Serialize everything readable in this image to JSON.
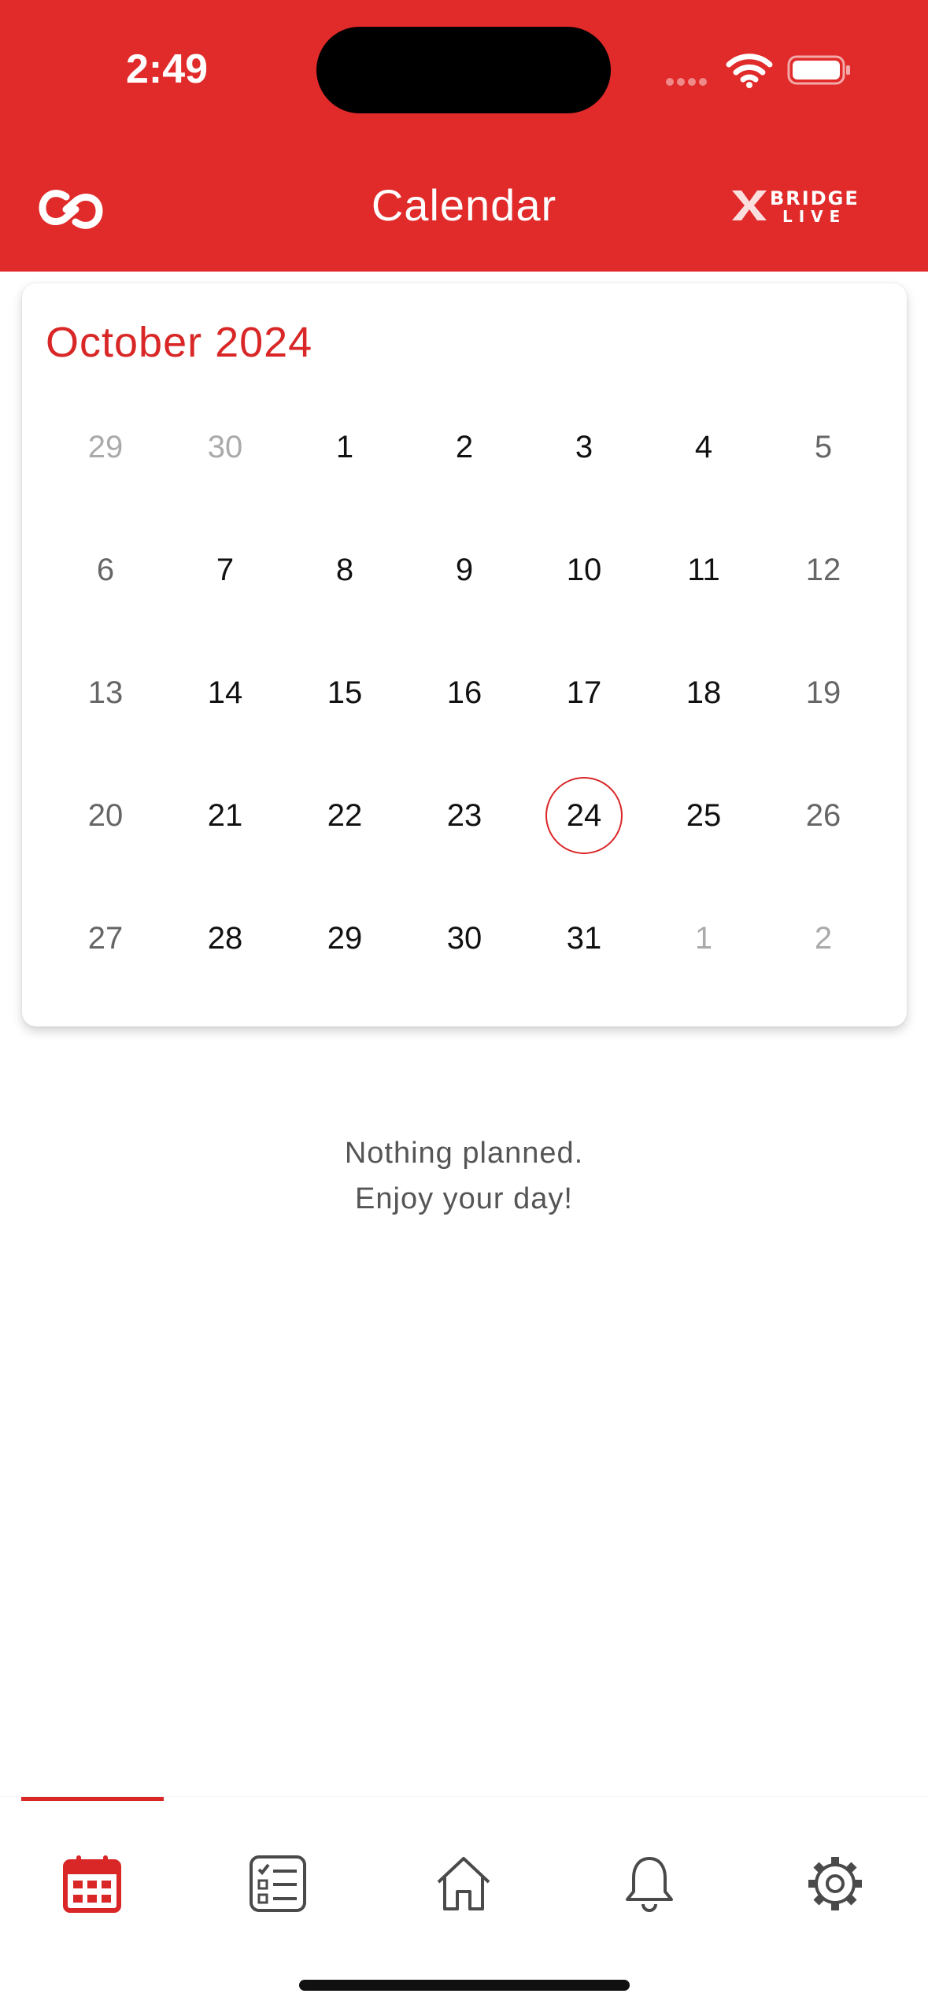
{
  "status_bar": {
    "time": "2:49"
  },
  "header": {
    "title": "Calendar",
    "brand_top": "BRIDGE",
    "brand_bottom": "LIVE"
  },
  "calendar": {
    "month_label": "October 2024",
    "selected_day": "24",
    "weeks": [
      [
        {
          "d": "29",
          "m": true
        },
        {
          "d": "30",
          "m": true
        },
        {
          "d": "1"
        },
        {
          "d": "2"
        },
        {
          "d": "3"
        },
        {
          "d": "4"
        },
        {
          "d": "5",
          "w": true
        }
      ],
      [
        {
          "d": "6",
          "w": true
        },
        {
          "d": "7"
        },
        {
          "d": "8"
        },
        {
          "d": "9"
        },
        {
          "d": "10"
        },
        {
          "d": "11"
        },
        {
          "d": "12",
          "w": true
        }
      ],
      [
        {
          "d": "13",
          "w": true
        },
        {
          "d": "14"
        },
        {
          "d": "15"
        },
        {
          "d": "16"
        },
        {
          "d": "17"
        },
        {
          "d": "18"
        },
        {
          "d": "19",
          "w": true
        }
      ],
      [
        {
          "d": "20",
          "w": true
        },
        {
          "d": "21"
        },
        {
          "d": "22"
        },
        {
          "d": "23"
        },
        {
          "d": "24",
          "t": true
        },
        {
          "d": "25"
        },
        {
          "d": "26",
          "w": true
        }
      ],
      [
        {
          "d": "27",
          "w": true
        },
        {
          "d": "28"
        },
        {
          "d": "29"
        },
        {
          "d": "30"
        },
        {
          "d": "31"
        },
        {
          "d": "1",
          "m": true
        },
        {
          "d": "2",
          "m": true
        }
      ]
    ]
  },
  "empty_state": {
    "line1": "Nothing planned.",
    "line2": "Enjoy your day!"
  },
  "tabs": [
    {
      "icon": "calendar-icon",
      "active": true
    },
    {
      "icon": "checklist-icon",
      "active": false
    },
    {
      "icon": "home-icon",
      "active": false
    },
    {
      "icon": "bell-icon",
      "active": false
    },
    {
      "icon": "gear-icon",
      "active": false
    }
  ],
  "colors": {
    "accent": "#e12a2a",
    "today_ring": "#d92626",
    "icon_inactive": "#4a4a4a"
  }
}
